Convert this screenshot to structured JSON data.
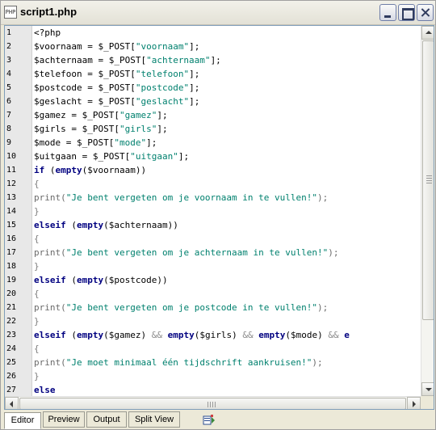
{
  "window": {
    "title": "script1.php",
    "icon": "php-file-icon",
    "controls": [
      "minimize",
      "maximize",
      "close"
    ]
  },
  "editor": {
    "lines": [
      {
        "n": "1",
        "tokens": [
          {
            "t": "<?php",
            "c": "tag"
          }
        ]
      },
      {
        "n": "2",
        "tokens": [
          {
            "t": "$voornaam = $_POST[",
            "c": "plain"
          },
          {
            "t": "\"voornaam\"",
            "c": "str"
          },
          {
            "t": "];",
            "c": "plain"
          }
        ]
      },
      {
        "n": "3",
        "tokens": [
          {
            "t": "$achternaam = $_POST[",
            "c": "plain"
          },
          {
            "t": "\"achternaam\"",
            "c": "str"
          },
          {
            "t": "];",
            "c": "plain"
          }
        ]
      },
      {
        "n": "4",
        "tokens": [
          {
            "t": "$telefoon = $_POST[",
            "c": "plain"
          },
          {
            "t": "\"telefoon\"",
            "c": "str"
          },
          {
            "t": "];",
            "c": "plain"
          }
        ]
      },
      {
        "n": "5",
        "tokens": [
          {
            "t": "$postcode = $_POST[",
            "c": "plain"
          },
          {
            "t": "\"postcode\"",
            "c": "str"
          },
          {
            "t": "];",
            "c": "plain"
          }
        ]
      },
      {
        "n": "6",
        "tokens": [
          {
            "t": "$geslacht = $_POST[",
            "c": "plain"
          },
          {
            "t": "\"geslacht\"",
            "c": "str"
          },
          {
            "t": "];",
            "c": "plain"
          }
        ]
      },
      {
        "n": "7",
        "tokens": [
          {
            "t": "$gamez = $_POST[",
            "c": "plain"
          },
          {
            "t": "\"gamez\"",
            "c": "str"
          },
          {
            "t": "];",
            "c": "plain"
          }
        ]
      },
      {
        "n": "8",
        "tokens": [
          {
            "t": "$girls = $_POST[",
            "c": "plain"
          },
          {
            "t": "\"girls\"",
            "c": "str"
          },
          {
            "t": "];",
            "c": "plain"
          }
        ]
      },
      {
        "n": "9",
        "tokens": [
          {
            "t": "$mode = $_POST[",
            "c": "plain"
          },
          {
            "t": "\"mode\"",
            "c": "str"
          },
          {
            "t": "];",
            "c": "plain"
          }
        ]
      },
      {
        "n": "10",
        "tokens": [
          {
            "t": "$uitgaan = $_POST[",
            "c": "plain"
          },
          {
            "t": "\"uitgaan\"",
            "c": "str"
          },
          {
            "t": "];",
            "c": "plain"
          }
        ]
      },
      {
        "n": "11",
        "tokens": [
          {
            "t": "if",
            "c": "kw"
          },
          {
            "t": " (",
            "c": "plain"
          },
          {
            "t": "empty",
            "c": "fn"
          },
          {
            "t": "($voornaam))",
            "c": "plain"
          }
        ]
      },
      {
        "n": "12",
        "tokens": [
          {
            "t": "{",
            "c": "brace"
          }
        ]
      },
      {
        "n": "13",
        "tokens": [
          {
            "t": "print(",
            "c": "print"
          },
          {
            "t": "\"Je bent vergeten om je voornaam in te vullen!\"",
            "c": "str"
          },
          {
            "t": ");",
            "c": "print"
          }
        ]
      },
      {
        "n": "14",
        "tokens": [
          {
            "t": "}",
            "c": "brace"
          }
        ]
      },
      {
        "n": "15",
        "tokens": [
          {
            "t": "elseif",
            "c": "kw"
          },
          {
            "t": " (",
            "c": "plain"
          },
          {
            "t": "empty",
            "c": "fn"
          },
          {
            "t": "($achternaam))",
            "c": "plain"
          }
        ]
      },
      {
        "n": "16",
        "tokens": [
          {
            "t": "{",
            "c": "brace"
          }
        ]
      },
      {
        "n": "17",
        "tokens": [
          {
            "t": "print(",
            "c": "print"
          },
          {
            "t": "\"Je bent vergeten om je achternaam in te vullen!\"",
            "c": "str"
          },
          {
            "t": ");",
            "c": "print"
          }
        ]
      },
      {
        "n": "18",
        "tokens": [
          {
            "t": "}",
            "c": "brace"
          }
        ]
      },
      {
        "n": "19",
        "tokens": [
          {
            "t": "elseif",
            "c": "kw"
          },
          {
            "t": " (",
            "c": "plain"
          },
          {
            "t": "empty",
            "c": "fn"
          },
          {
            "t": "($postcode))",
            "c": "plain"
          }
        ]
      },
      {
        "n": "20",
        "tokens": [
          {
            "t": "{",
            "c": "brace"
          }
        ]
      },
      {
        "n": "21",
        "tokens": [
          {
            "t": "print(",
            "c": "print"
          },
          {
            "t": "\"Je bent vergeten om je postcode in te vullen!\"",
            "c": "str"
          },
          {
            "t": ");",
            "c": "print"
          }
        ]
      },
      {
        "n": "22",
        "tokens": [
          {
            "t": "}",
            "c": "brace"
          }
        ]
      },
      {
        "n": "23",
        "tokens": [
          {
            "t": "elseif",
            "c": "kw"
          },
          {
            "t": " (",
            "c": "plain"
          },
          {
            "t": "empty",
            "c": "fn"
          },
          {
            "t": "($gamez) ",
            "c": "plain"
          },
          {
            "t": "&&",
            "c": "op"
          },
          {
            "t": " ",
            "c": "plain"
          },
          {
            "t": "empty",
            "c": "fn"
          },
          {
            "t": "($girls) ",
            "c": "plain"
          },
          {
            "t": "&&",
            "c": "op"
          },
          {
            "t": " ",
            "c": "plain"
          },
          {
            "t": "empty",
            "c": "fn"
          },
          {
            "t": "($mode) ",
            "c": "plain"
          },
          {
            "t": "&&",
            "c": "op"
          },
          {
            "t": " e",
            "c": "fn"
          }
        ]
      },
      {
        "n": "24",
        "tokens": [
          {
            "t": "{",
            "c": "brace"
          }
        ]
      },
      {
        "n": "25",
        "tokens": [
          {
            "t": "print(",
            "c": "print"
          },
          {
            "t": "\"Je moet minimaal één tijdschrift aankruisen!\"",
            "c": "str"
          },
          {
            "t": ");",
            "c": "print"
          }
        ]
      },
      {
        "n": "26",
        "tokens": [
          {
            "t": "}",
            "c": "brace"
          }
        ]
      },
      {
        "n": "27",
        "tokens": [
          {
            "t": "else",
            "c": "kw"
          }
        ]
      }
    ]
  },
  "tabs": [
    {
      "label": "Editor",
      "active": true
    },
    {
      "label": "Preview",
      "active": false
    },
    {
      "label": "Output",
      "active": false
    },
    {
      "label": "Split View",
      "active": false
    }
  ],
  "toolbar": {
    "icon": "split-toggle-icon"
  },
  "colors": {
    "string": "#00806e",
    "keyword": "#000080",
    "brace": "#7c7c7c",
    "gutter": "#e8e8e8"
  }
}
